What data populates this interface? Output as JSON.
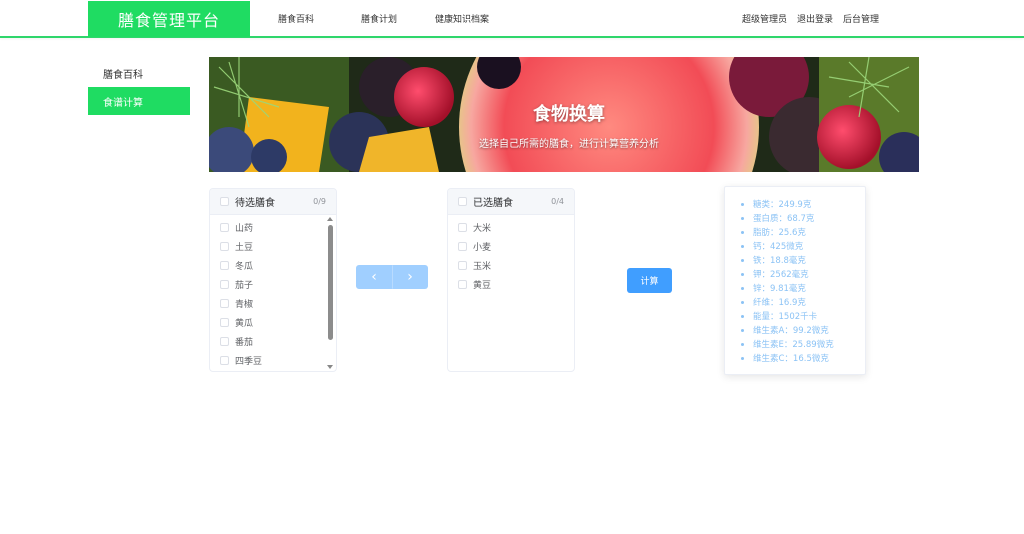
{
  "app": {
    "title": "膳食管理平台"
  },
  "nav": {
    "items": [
      "膳食百科",
      "膳食计划",
      "健康知识档案"
    ],
    "right": [
      "超级管理员",
      "退出登录",
      "后台管理"
    ]
  },
  "sidebar": {
    "items": [
      {
        "label": "膳食百科",
        "active": false
      },
      {
        "label": "食谱计算",
        "active": true
      }
    ]
  },
  "banner": {
    "title": "食物换算",
    "subtitle": "选择自己所需的膳食，进行计算营养分析"
  },
  "transfer": {
    "left": {
      "title": "待选膳食",
      "count": "0/9",
      "items": [
        "山药",
        "土豆",
        "冬瓜",
        "茄子",
        "青椒",
        "黄瓜",
        "番茄",
        "四季豆"
      ]
    },
    "right": {
      "title": "已选膳食",
      "count": "0/4",
      "items": [
        "大米",
        "小麦",
        "玉米",
        "黄豆"
      ]
    },
    "left_arrow": "‹",
    "right_arrow": "›"
  },
  "calc_button": "计算",
  "results": [
    "糖类：249.9克",
    "蛋白质：68.7克",
    "脂肪：25.6克",
    "钙：425微克",
    "铁：18.8毫克",
    "钾：2562毫克",
    "锌：9.81毫克",
    "纤维：16.9克",
    "能量：1502千卡",
    "维生素A：99.2微克",
    "维生素E：25.89微克",
    "维生素C：16.5微克"
  ],
  "colors": {
    "brand": "#1fdc62",
    "primary": "#409eff",
    "result_text": "#8cc3f5"
  }
}
